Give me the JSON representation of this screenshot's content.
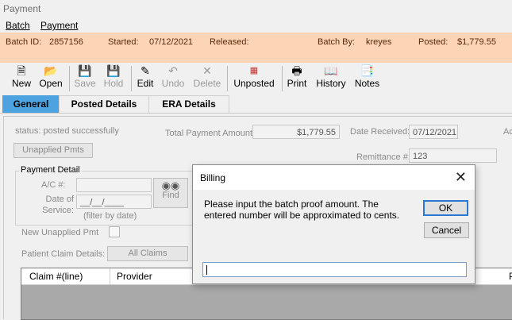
{
  "window": {
    "title": "Payment"
  },
  "menu": {
    "batch": "Batch",
    "payment": "Payment"
  },
  "batch_info": {
    "batch_id_label": "Batch ID:",
    "batch_id": "2857156",
    "started_label": "Started:",
    "started": "07/12/2021",
    "released_label": "Released:",
    "batch_by_label": "Batch By:",
    "batch_by": "kreyes",
    "posted_label": "Posted:",
    "posted": "$1,779.55"
  },
  "toolbar": {
    "new": "New",
    "open": "Open",
    "save": "Save",
    "hold": "Hold",
    "edit": "Edit",
    "undo": "Undo",
    "delete": "Delete",
    "unposted": "Unposted",
    "print": "Print",
    "history": "History",
    "notes": "Notes"
  },
  "tabs": [
    "General",
    "Posted Details",
    "ERA Details"
  ],
  "general": {
    "status": "status:  posted successfully",
    "total_payment_label": "Total Payment Amount:",
    "total_payment": "$1,779.55",
    "date_received_label": "Date Received:",
    "date_received": "07/12/2021",
    "ac_truncated": "Ac",
    "unapplied_pmts": "Unapplied Pmts",
    "remittance_label": "Remittance #:",
    "remittance": "123",
    "payment_detail": "Payment Detail",
    "ac_label": "A/C #:",
    "date_of_service_label": "Date of Service:",
    "date_placeholder": "__/__/____",
    "filter_hint": "(filter by date)",
    "find": "Find",
    "new_unapplied_pmt": "New Unapplied Pmt",
    "patient_claim_details": "Patient Claim Details:",
    "all_claims": "All Claims",
    "columns": [
      "Claim #(line)",
      "Provider",
      "P"
    ]
  },
  "dialog": {
    "title": "Billing",
    "message": "Please input the batch proof amount. The entered number will be approximated to cents.",
    "ok": "OK",
    "cancel": "Cancel",
    "input_value": ""
  }
}
